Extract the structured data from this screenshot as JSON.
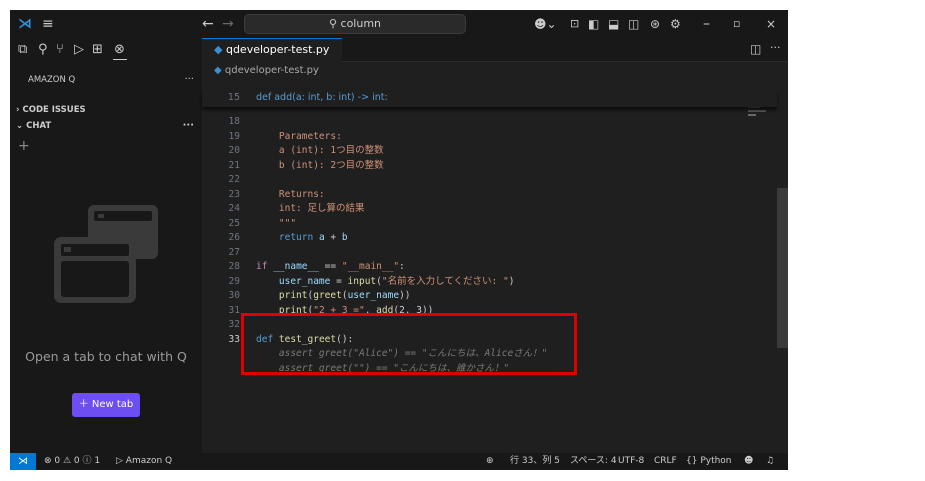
{
  "titlebar": {
    "search_text": "column"
  },
  "sidebar": {
    "section_title": "AMAZON Q",
    "code_issues": "CODE ISSUES",
    "chat": "CHAT",
    "plus": "+",
    "empty_message": "Open a tab to chat with Q",
    "new_tab_label": "New tab"
  },
  "tabs": [
    {
      "label": "qdeveloper-test.py"
    }
  ],
  "breadcrumb": "qdeveloper-test.py",
  "editor": {
    "sticky_line_number": "15",
    "sticky_code": "def add(a: int, b: int) -> int:",
    "line_numbers": [
      "18",
      "19",
      "20",
      "21",
      "22",
      "23",
      "24",
      "25",
      "26",
      "27",
      "28",
      "29",
      "30",
      "31",
      "32",
      "33"
    ],
    "lines": [
      "",
      "    Parameters:",
      "    a (int): 1つ目の整数",
      "    b (int): 2つ目の整数",
      "",
      "    Returns:",
      "    int: 足し算の結果",
      "    \"\"\"",
      "    return a + b",
      "",
      "if __name__ == \"__main__\":",
      "    user_name = input(\"名前を入力してください: \")",
      "    print(greet(user_name))",
      "    print(\"2 + 3 =\", add(2, 3))",
      "",
      "def test_greet():"
    ],
    "ghost_lines": [
      "    assert greet(\"Alice\") == \"こんにちは、Aliceさん！\"",
      "    assert greet(\"\") == \"こんにちは、誰かさん！\""
    ]
  },
  "statusbar": {
    "problems": "⊗ 0 ⚠ 0 ⓘ 1",
    "amazon_q": "Amazon Q",
    "position": "行 33、列 5",
    "spaces": "スペース: 4",
    "encoding": "UTF-8",
    "eol": "CRLF",
    "language": "{} Python"
  },
  "colors": {
    "accent": "#0078d4",
    "new_tab_button": "#6d4ef2",
    "highlight_box": "#e00000"
  }
}
